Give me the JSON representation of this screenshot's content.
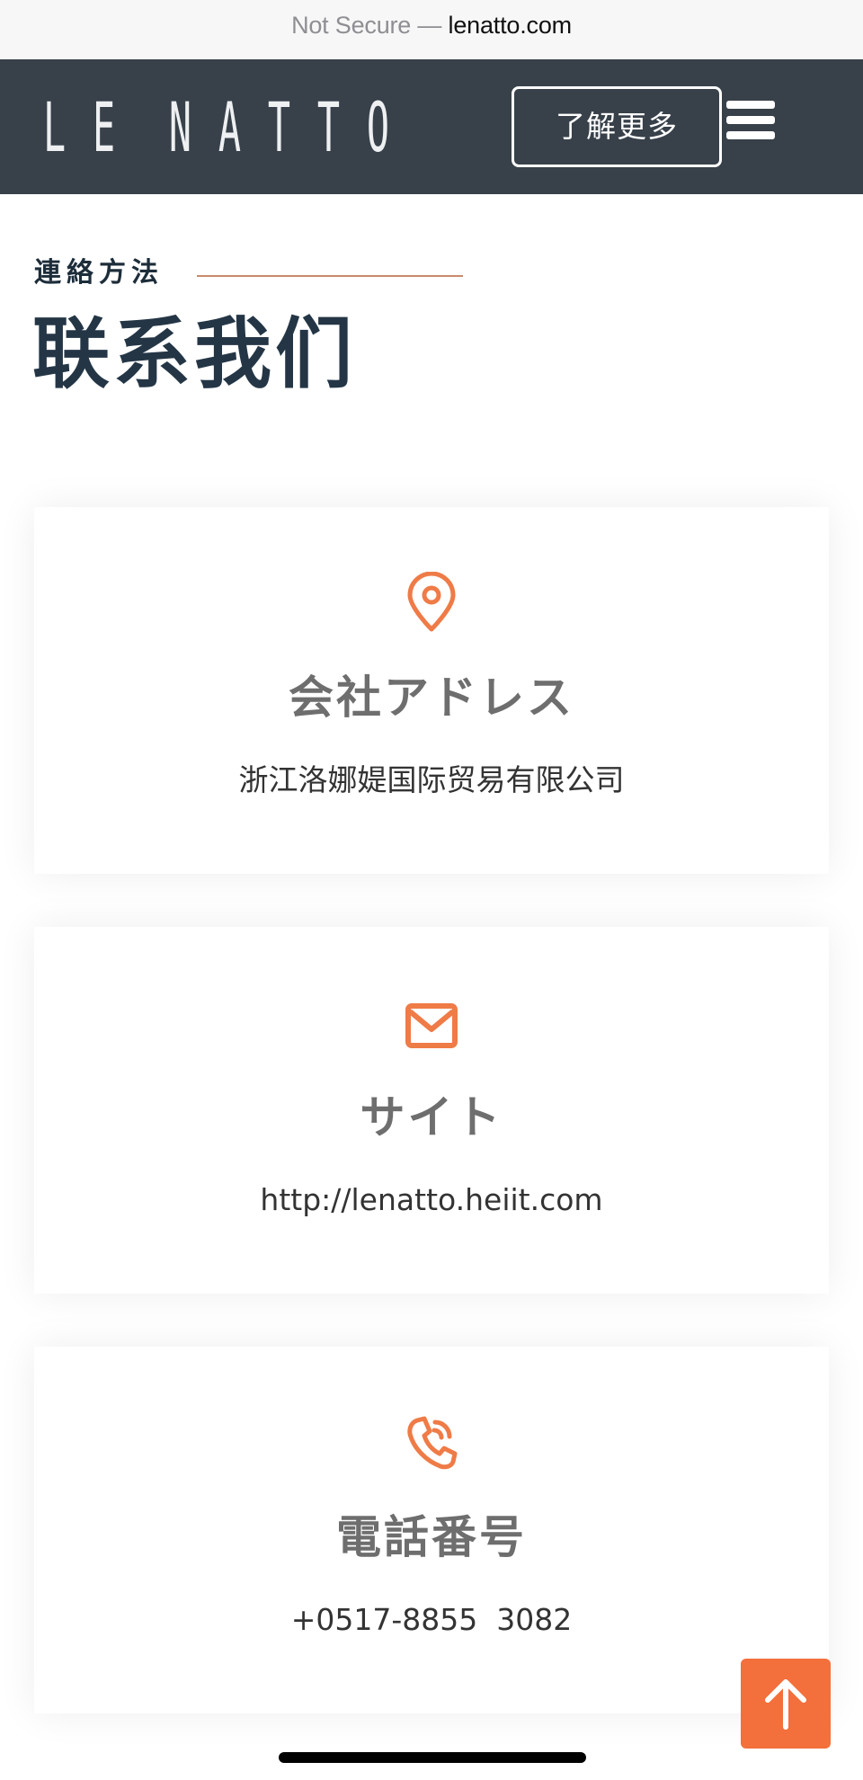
{
  "browser": {
    "security_label": "Not Secure —",
    "domain": "lenatto.com"
  },
  "header": {
    "logo_letters": [
      "L",
      "E",
      "",
      "N",
      "A",
      "T",
      "T",
      "O"
    ],
    "logo_text": "LE NATTO",
    "learn_more_label": "了解更多",
    "menu_icon": "hamburger-icon"
  },
  "section": {
    "eyebrow": "連絡方法",
    "title": "联系我们"
  },
  "cards": [
    {
      "icon": "map-pin-icon",
      "title": "会社アドレス",
      "value": "浙江洛娜媞国际贸易有限公司"
    },
    {
      "icon": "envelope-icon",
      "title": "サイト",
      "value": "http://lenatto.heiit.com"
    },
    {
      "icon": "phone-icon",
      "title": "電話番号",
      "value": "+0517-8855  3082"
    }
  ],
  "back_to_top": {
    "icon": "arrow-up-icon",
    "color": "#f36f3b"
  },
  "colors": {
    "header_bg": "#38414a",
    "accent": "#ef7b47",
    "title_text": "#243646",
    "card_title": "#6e6e6e"
  }
}
